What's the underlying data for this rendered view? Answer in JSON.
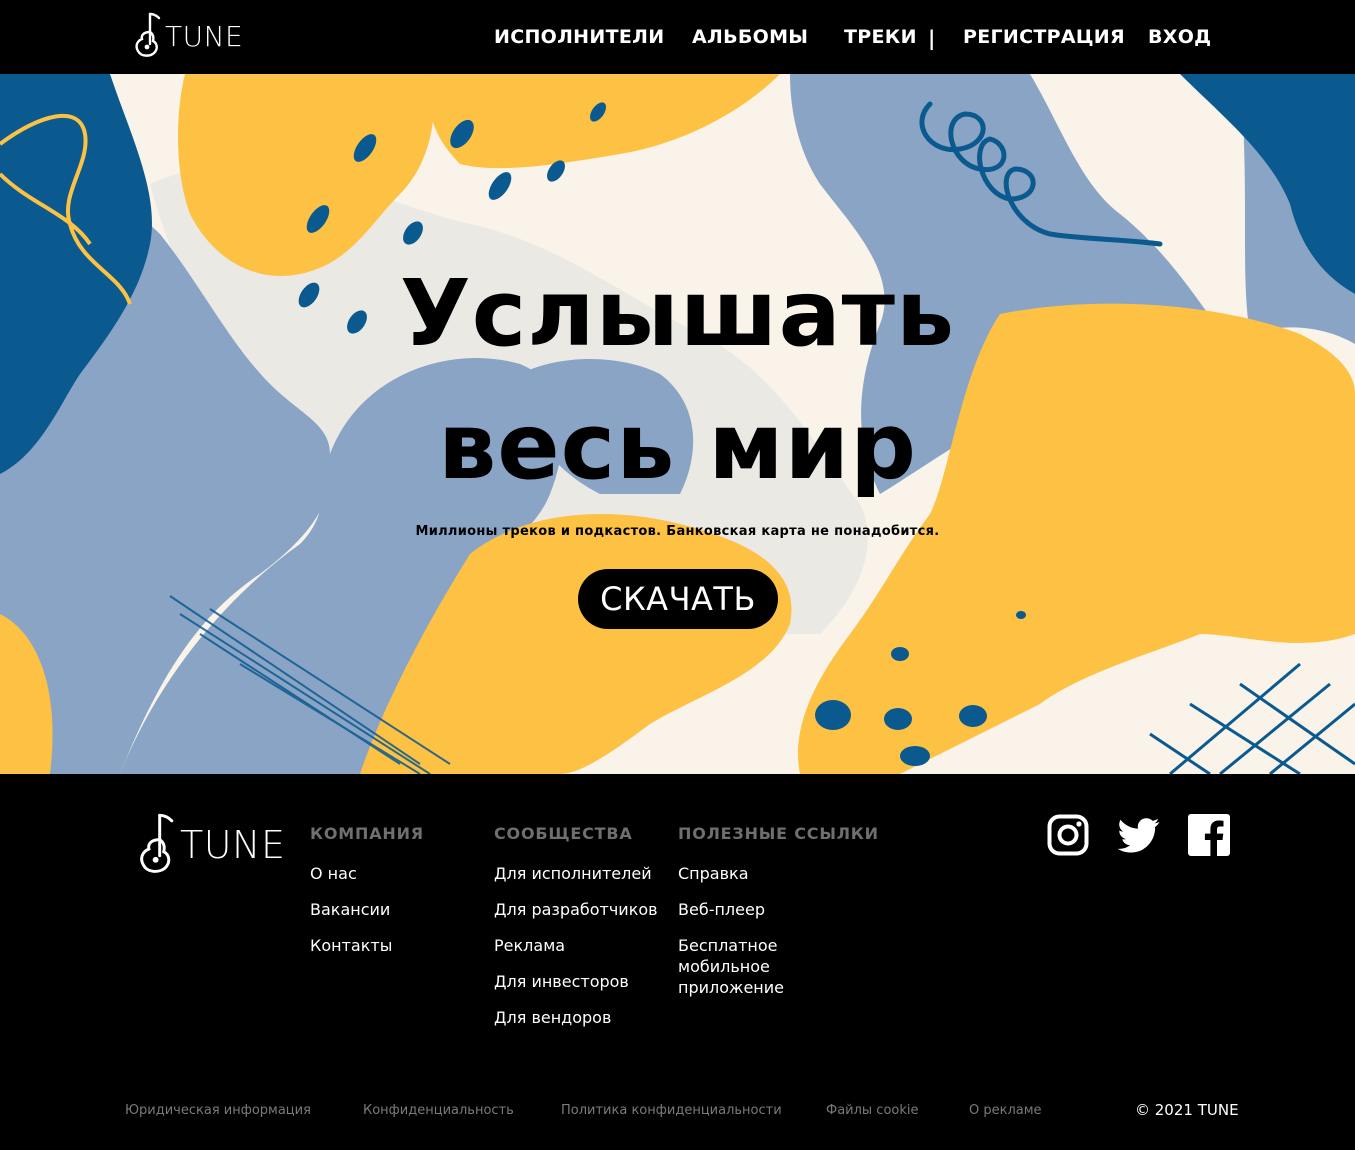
{
  "brand": {
    "name": "TUNE"
  },
  "nav": {
    "items": [
      "ИСПОЛНИТЕЛИ",
      "АЛЬБОМЫ",
      "ТРЕКИ"
    ],
    "separator": "|",
    "register": "РЕГИСТРАЦИЯ",
    "login": "ВХОД"
  },
  "hero": {
    "title_line1": "Услышать",
    "title_line2": "весь мир",
    "subtitle": "Миллионы треков и подкастов. Банковская карта не понадобится.",
    "button": "СКАЧАТЬ"
  },
  "footer": {
    "columns": [
      {
        "title": "КОМПАНИЯ",
        "links": [
          "О нас",
          "Вакансии",
          "Контакты"
        ]
      },
      {
        "title": "СООБЩЕСТВА",
        "links": [
          "Для исполнителей",
          "Для разработчиков",
          "Реклама",
          "Для инвесторов",
          "Для вендоров"
        ]
      },
      {
        "title": "ПОЛЕЗНЫЕ ССЫЛКИ",
        "links": [
          "Справка",
          "Веб-плеер",
          "Бесплатное мобильное приложение"
        ]
      }
    ],
    "socials": [
      "instagram-icon",
      "twitter-icon",
      "facebook-icon"
    ],
    "legal": [
      "Юридическая информация",
      "Конфиденциальность",
      "Политика конфиденциальности",
      "Файлы cookie",
      "О рекламе"
    ],
    "copyright": "© 2021 TUNE"
  },
  "colors": {
    "background": "#000000",
    "navy": "#0b5a8f",
    "yellow": "#fdc144",
    "slate": "#8aa4c5",
    "cream": "#f9f3ea",
    "muted_text": "#7a7a7a"
  }
}
